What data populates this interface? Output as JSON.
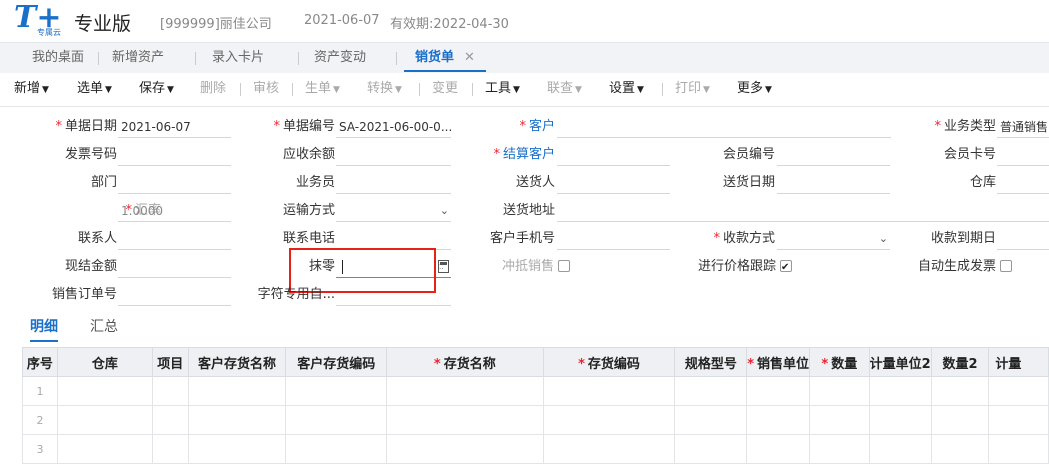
{
  "header": {
    "logo_text": "T+",
    "logo_sub": "专属云",
    "app_name": "专业版",
    "company": "[999999]丽佳公司",
    "date": "2021-06-07",
    "expiry": "有效期:2022-04-30"
  },
  "tabs": [
    {
      "label": "我的桌面"
    },
    {
      "label": "新增资产"
    },
    {
      "label": "录入卡片"
    },
    {
      "label": "资产变动"
    },
    {
      "label": "销货单",
      "close": "✕"
    }
  ],
  "toolbar": {
    "new": "新增",
    "select": "选单",
    "save": "保存",
    "delete": "删除",
    "audit": "审核",
    "generate": "生单",
    "convert": "转换",
    "change": "变更",
    "tools": "工具",
    "linked": "联查",
    "settings": "设置",
    "print": "打印",
    "more": "更多"
  },
  "form": {
    "doc_date_label": "单据日期",
    "doc_date_value": "2021-06-07",
    "doc_no_label": "单据编号",
    "doc_no_value": "SA-2021-06-00-0...",
    "customer_label": "客户",
    "biz_type_label": "业务类型",
    "biz_type_value": "普通销售",
    "invoice_no_label": "发票号码",
    "receivable_label": "应收余额",
    "settle_customer_label": "结算客户",
    "member_no_label": "会员编号",
    "member_card_label": "会员卡号",
    "dept_label": "部门",
    "salesman_label": "业务员",
    "deliverer_label": "送货人",
    "delivery_date_label": "送货日期",
    "warehouse_label": "仓库",
    "rate_label": "汇率",
    "rate_value": "1.0000",
    "transport_label": "运输方式",
    "address_label": "送货地址",
    "contact_label": "联系人",
    "contact_phone_label": "联系电话",
    "mobile_label": "客户手机号",
    "payment_label": "收款方式",
    "due_label": "收款到期日",
    "cash_label": "现结金额",
    "rounding_label": "抹零",
    "offset_label": "冲抵销售",
    "price_track_label": "进行价格跟踪",
    "auto_invoice_label": "自动生成发票",
    "order_no_label": "销售订单号",
    "char_label": "字符专用自..."
  },
  "subtabs": {
    "detail": "明细",
    "summary": "汇总"
  },
  "grid": {
    "columns": [
      "序号",
      "仓库",
      "项目",
      "客户存货名称",
      "客户存货编码",
      "存货名称",
      "存货编码",
      "规格型号",
      "销售单位",
      "数量",
      "计量单位2",
      "数量2",
      "计量"
    ],
    "rows": [
      "1",
      "2",
      "3"
    ]
  }
}
